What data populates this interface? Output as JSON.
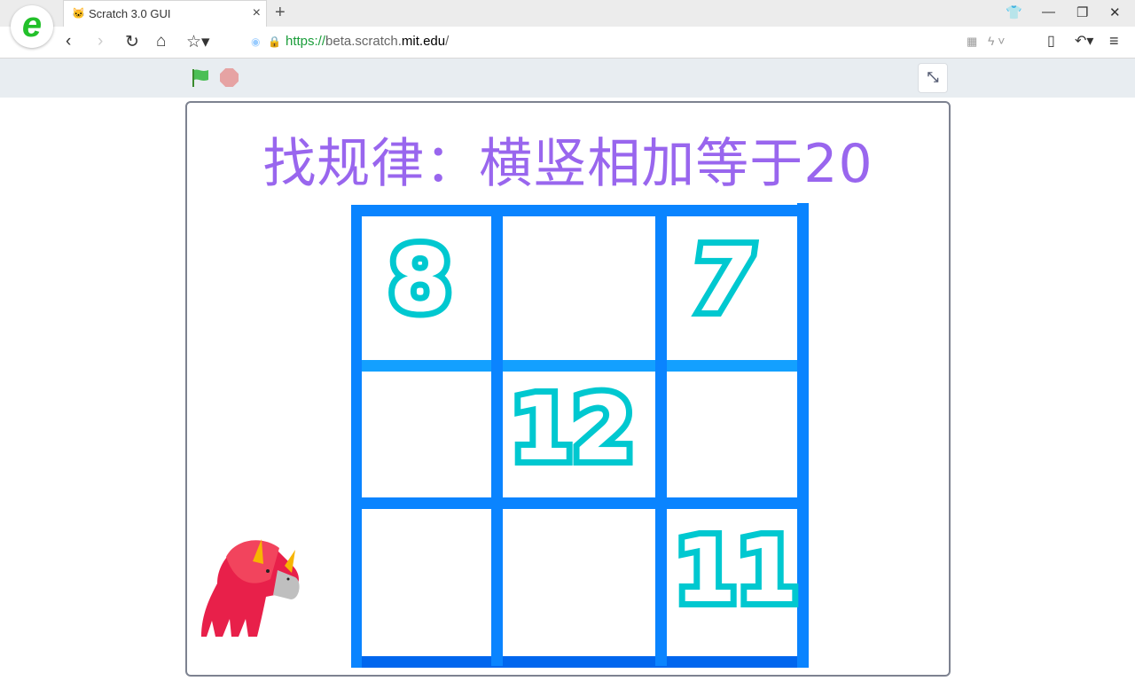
{
  "browser": {
    "tab_title": "Scratch 3.0 GUI",
    "url_scheme": "https://",
    "url_host_pre": "beta.scratch.",
    "url_host_domain": "mit.edu",
    "url_path": "/"
  },
  "stage": {
    "title": "找规律：横竖相加等于20",
    "grid": [
      [
        "8",
        "",
        "7"
      ],
      [
        "",
        "12",
        ""
      ],
      [
        "",
        "",
        "11"
      ]
    ],
    "colors": {
      "title": "#9966ee",
      "grid": "#0a84ff",
      "numbers": "#00c8d0"
    }
  },
  "icons": [
    "browser-logo-icon",
    "back-icon",
    "forward-icon",
    "reload-icon",
    "home-icon",
    "star-icon",
    "lock-icon",
    "green-flag-icon",
    "stop-icon",
    "unfullscreen-icon"
  ]
}
